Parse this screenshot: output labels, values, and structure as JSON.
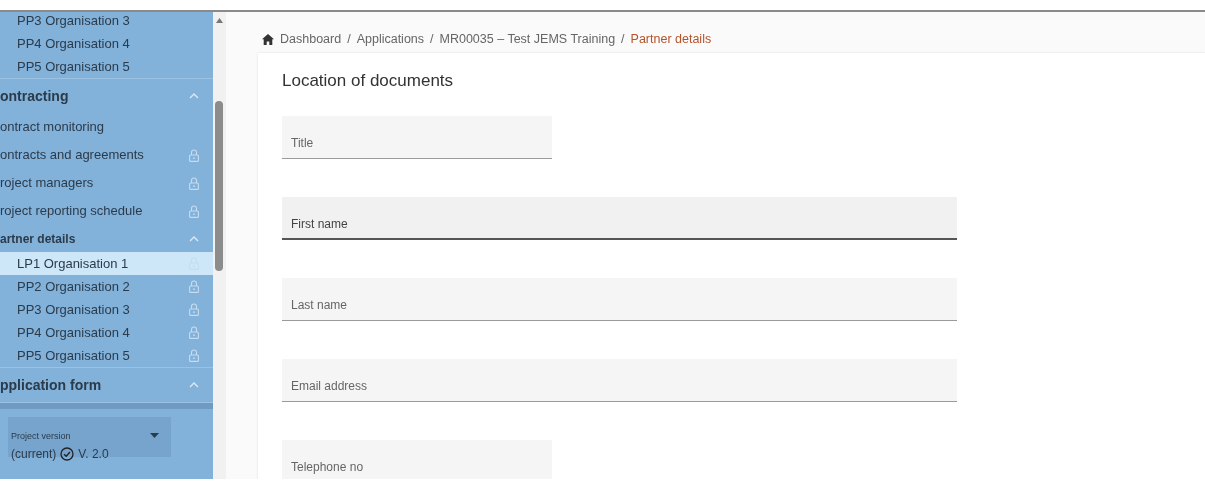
{
  "sidebar": {
    "sections": [
      {
        "items": [
          {
            "label": "PP3 Organisation 3",
            "locked": false,
            "selected": false
          },
          {
            "label": "PP4 Organisation 4",
            "locked": false,
            "selected": false
          },
          {
            "label": "PP5 Organisation 5",
            "locked": false,
            "selected": false
          }
        ]
      },
      {
        "title": "ontracting",
        "expanded": true,
        "items": [
          {
            "label": "ontract monitoring",
            "locked": false,
            "selected": false
          },
          {
            "label": "ontracts and agreements",
            "locked": true,
            "selected": false
          },
          {
            "label": "roject managers",
            "locked": true,
            "selected": false
          },
          {
            "label": "roject reporting schedule",
            "locked": true,
            "selected": false
          },
          {
            "label": "artner details",
            "expanded": true,
            "children": [
              {
                "label": "LP1 Organisation 1",
                "locked": true,
                "selected": true
              },
              {
                "label": "PP2 Organisation 2",
                "locked": true,
                "selected": false
              },
              {
                "label": "PP3 Organisation 3",
                "locked": true,
                "selected": false
              },
              {
                "label": "PP4 Organisation 4",
                "locked": true,
                "selected": false
              },
              {
                "label": "PP5 Organisation 5",
                "locked": true,
                "selected": false
              }
            ]
          }
        ]
      },
      {
        "title": "pplication form",
        "expanded": true
      }
    ],
    "project_version": {
      "label": "Project version",
      "value": "(current)",
      "version": "V. 2.0"
    }
  },
  "breadcrumb": [
    {
      "label": "Dashboard"
    },
    {
      "separator": "/",
      "label": "Applications"
    },
    {
      "separator": "/",
      "label": "MR00035 – Test JEMS Training"
    },
    {
      "separator": "/",
      "label": "Partner details"
    }
  ],
  "form": {
    "title": "Location of documents",
    "fields": [
      {
        "placeholder": "Title",
        "kind": "short",
        "focused": false
      },
      {
        "placeholder": "First name",
        "kind": "long",
        "focused": true
      },
      {
        "placeholder": "Last name",
        "kind": "long",
        "focused": false
      },
      {
        "placeholder": "Email address",
        "kind": "long",
        "focused": false
      },
      {
        "placeholder": "Telephone no",
        "kind": "short",
        "focused": false
      }
    ]
  }
}
